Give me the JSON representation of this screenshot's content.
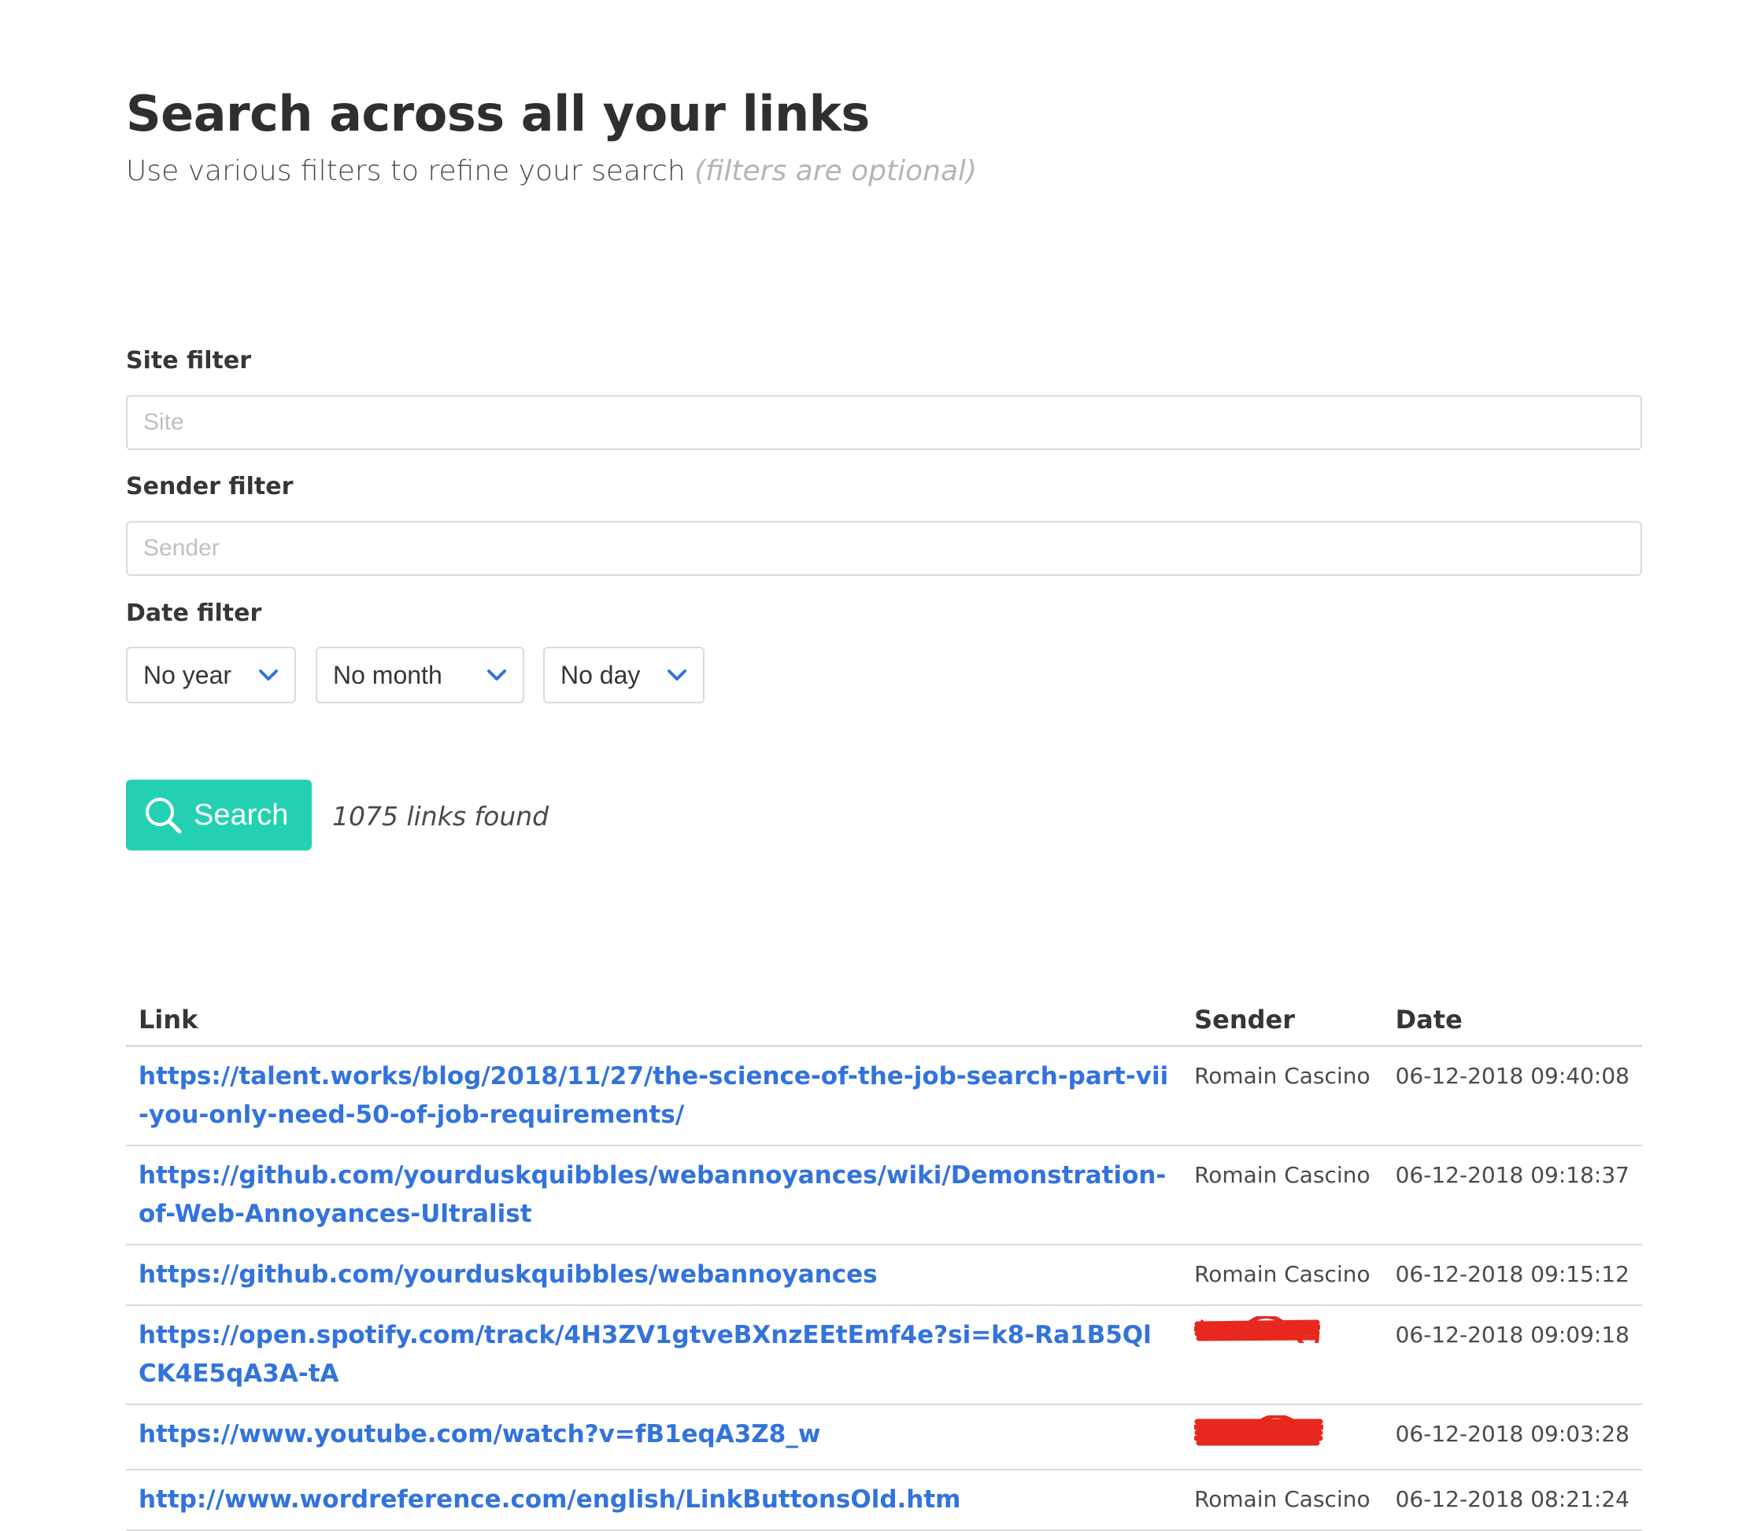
{
  "header": {
    "title": "Search across all your links",
    "subtitle": "Use various filters to refine your search",
    "subtitle_optional": "(filters are optional)"
  },
  "filters": {
    "site_label": "Site filter",
    "site_placeholder": "Site",
    "sender_label": "Sender filter",
    "sender_placeholder": "Sender",
    "date_label": "Date filter",
    "year_value": "No year",
    "month_value": "No month",
    "day_value": "No day"
  },
  "search": {
    "button_label": "Search",
    "button_icon": "search-icon",
    "results_count": "1075 links found"
  },
  "colors": {
    "accent": "#23d1b2",
    "link": "#3273dc",
    "redaction": "#e8281e"
  },
  "table": {
    "headers": {
      "link": "Link",
      "sender": "Sender",
      "date": "Date"
    },
    "rows": [
      {
        "link": "https://talent.works/blog/2018/11/27/the-science-of-the-job-search-part-vii-you-only-need-50-of-job-requirements/",
        "sender": "Romain Cascino",
        "date": "06-12-2018 09:40:08"
      },
      {
        "link": "https://github.com/yourduskquibbles/webannoyances/wiki/Demonstration-of-Web-Annoyances-Ultralist",
        "sender": "Romain Cascino",
        "date": "06-12-2018 09:18:37"
      },
      {
        "link": "https://github.com/yourduskquibbles/webannoyances",
        "sender": "Romain Cascino",
        "date": "06-12-2018 09:15:12"
      },
      {
        "link": "https://open.spotify.com/track/4H3ZV1gtveBXnzEEtEmf4e?si=k8-Ra1B5QlCK4E5qA3A-tA",
        "sender": "",
        "date": "06-12-2018 09:09:18"
      },
      {
        "link": "https://www.youtube.com/watch?v=fB1eqA3Z8_w",
        "sender": "",
        "date": "06-12-2018 09:03:28"
      },
      {
        "link": "http://www.wordreference.com/english/LinkButtonsOld.htm",
        "sender": "Romain Cascino",
        "date": "06-12-2018 08:21:24"
      }
    ]
  }
}
